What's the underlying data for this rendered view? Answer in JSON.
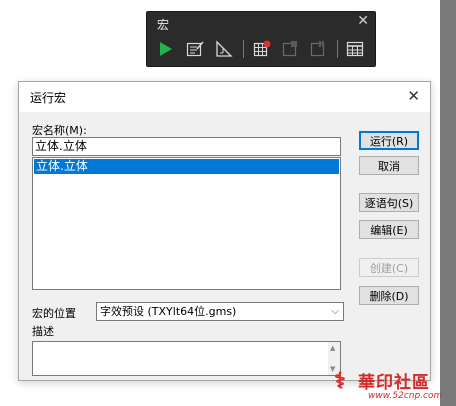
{
  "macro_toolbar": {
    "title": "宏",
    "close_glyph": "✕",
    "buttons": [
      {
        "name": "run-icon",
        "color": "#22b14c"
      },
      {
        "name": "edit-icon"
      },
      {
        "name": "triangle-ruler-icon"
      },
      {
        "name": "record-icon",
        "color": "#e03030"
      },
      {
        "name": "stop-icon"
      },
      {
        "name": "pause-icon"
      },
      {
        "name": "grid-icon"
      }
    ]
  },
  "dialog": {
    "title": "运行宏",
    "close_glyph": "✕",
    "name_label": "宏名称(M):",
    "name_value": "立体.立体",
    "macros": [
      "立体.立体"
    ],
    "buttons": {
      "run": "运行(R)",
      "cancel": "取消",
      "step": "逐语句(S)",
      "edit": "编辑(E)",
      "create": "创建(C)",
      "delete": "删除(D)"
    },
    "location_label": "宏的位置",
    "location_value": "字效预设 (TXYlt64位.gms)",
    "description_label": "描述",
    "description_value": ""
  },
  "watermark": {
    "logo": "⚕",
    "text": "華印社區",
    "url": "www.52cnp.com"
  },
  "colors": {
    "selection": "#0078d7",
    "toolbar_bg": "#2b2b2b",
    "watermark": "#d4282a"
  }
}
